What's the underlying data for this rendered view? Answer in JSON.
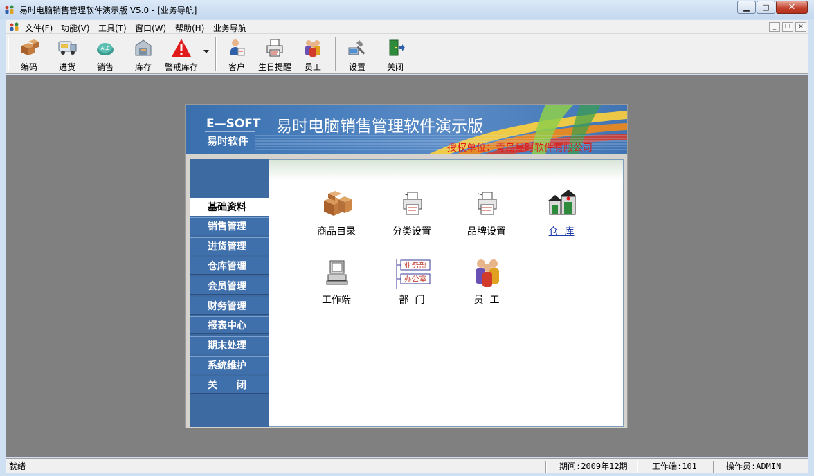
{
  "window": {
    "title": "易时电脑销售管理软件演示版 V5.0 - [业务导航]",
    "app_icon": "people-group-icon"
  },
  "menubar": {
    "items": [
      "文件(F)",
      "功能(V)",
      "工具(T)",
      "窗口(W)",
      "帮助(H)",
      "业务导航"
    ]
  },
  "toolbar": {
    "buttons": [
      {
        "label": "编码",
        "icon": "boxes-icon"
      },
      {
        "label": "进货",
        "icon": "truck-icon"
      },
      {
        "label": "销售",
        "icon": "sales-icon"
      },
      {
        "label": "库存",
        "icon": "warehouse-icon"
      },
      {
        "label": "警戒库存",
        "icon": "warning-icon"
      },
      {
        "label": "客户",
        "icon": "customer-icon"
      },
      {
        "label": "生日提醒",
        "icon": "printer-icon"
      },
      {
        "label": "员工",
        "icon": "staff-icon"
      },
      {
        "label": "设置",
        "icon": "settings-icon"
      },
      {
        "label": "关闭",
        "icon": "exit-door-icon"
      }
    ]
  },
  "panel": {
    "brand_en": "E—SOFT",
    "brand_cn": "易时软件",
    "title": "易时电脑销售管理软件演示版",
    "license": "授权单位：青岛易时软件有限公司",
    "nav": [
      "基础资料",
      "销售管理",
      "进货管理",
      "仓库管理",
      "会员管理",
      "财务管理",
      "报表中心",
      "期末处理",
      "系统维护",
      "关　　闭"
    ],
    "active_nav": "基础资料",
    "tiles": [
      {
        "label": "商品目录",
        "icon": "boxes-icon"
      },
      {
        "label": "分类设置",
        "icon": "printer-icon"
      },
      {
        "label": "品牌设置",
        "icon": "printer-icon"
      },
      {
        "label": "仓  库",
        "icon": "warehouse-houses-icon",
        "link": true
      },
      {
        "label": "工作端",
        "icon": "computer-icon"
      },
      {
        "label": "部  门",
        "icon": "org-chart-icon"
      },
      {
        "label": "员  工",
        "icon": "staff-icon"
      }
    ],
    "org_chart": {
      "node1": "业务部",
      "node2": "办公室"
    }
  },
  "statusbar": {
    "status": "就绪",
    "period": "期间:2009年12期",
    "terminal": "工作端:101",
    "operator": "操作员:ADMIN"
  },
  "colors": {
    "workspace": "#808080",
    "nav_blue": "#4070ab",
    "banner_blue": "#4b80bf",
    "license_red": "#e01a1a",
    "link_blue": "#1c3aa9"
  }
}
